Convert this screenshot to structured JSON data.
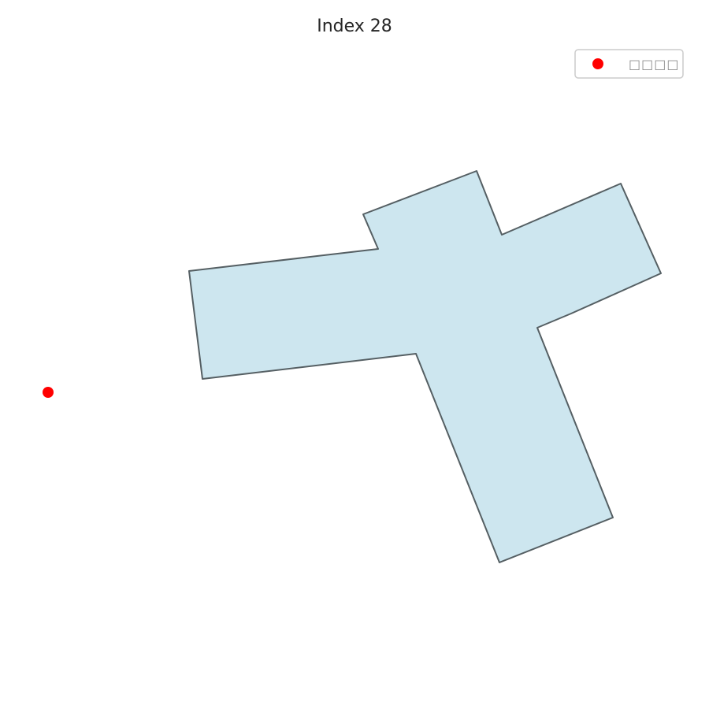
{
  "title": "Index 28",
  "legend": {
    "marker_label": "□□□□"
  },
  "colors": {
    "shape_fill": "#cde6ef",
    "shape_stroke": "#555f63",
    "point": "#ff0000",
    "legend_border": "#cccccc"
  }
}
